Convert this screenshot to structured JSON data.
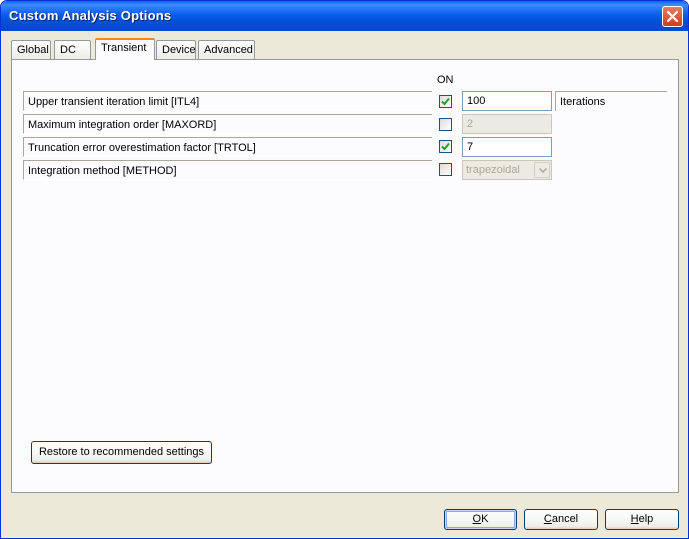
{
  "window": {
    "title": "Custom Analysis Options"
  },
  "tabs": [
    {
      "label": "Global"
    },
    {
      "label": "DC"
    },
    {
      "label": "Transient"
    },
    {
      "label": "Device"
    },
    {
      "label": "Advanced"
    }
  ],
  "active_tab": "Transient",
  "header": {
    "on_label": "ON"
  },
  "options": [
    {
      "label": "Upper transient iteration limit [ITL4]",
      "checked": true,
      "value": "100",
      "unit": "Iterations",
      "enabled": true
    },
    {
      "label": "Maximum integration order [MAXORD]",
      "checked": false,
      "value": "2",
      "enabled": false
    },
    {
      "label": "Truncation error overestimation factor [TRTOL]",
      "checked": true,
      "value": "7",
      "enabled": true
    },
    {
      "label": "Integration method [METHOD]",
      "checked": false,
      "selected": "trapezoidal",
      "enabled": false
    }
  ],
  "buttons": {
    "restore": "Restore to recommended settings",
    "ok": {
      "mnemonic": "O",
      "rest": "K"
    },
    "cancel": {
      "mnemonic": "C",
      "rest": "ancel"
    },
    "help": {
      "mnemonic": "H",
      "rest": "elp"
    }
  },
  "icons": {
    "close": "close-icon",
    "check": "checkmark-icon",
    "dropdown": "chevron-down-icon"
  },
  "colors": {
    "titlebar": "#0a5dee",
    "active_tab_accent": "#e68b2c",
    "check": "#21a121"
  }
}
